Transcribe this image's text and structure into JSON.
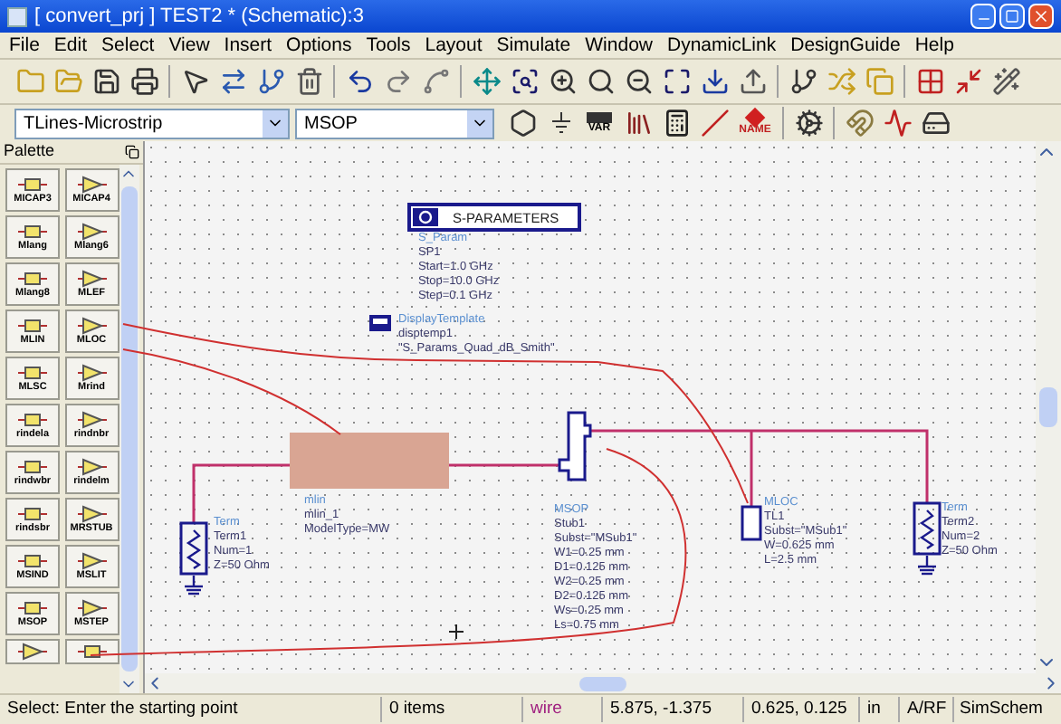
{
  "window": {
    "title": "[ convert_prj ] TEST2 * (Schematic):3"
  },
  "menu": [
    "File",
    "Edit",
    "Select",
    "View",
    "Insert",
    "Options",
    "Tools",
    "Layout",
    "Simulate",
    "Window",
    "DynamicLink",
    "DesignGuide",
    "Help"
  ],
  "component_bar": {
    "library": "TLines-Microstrip",
    "component": "MSOP",
    "var_icon_label": "VAR",
    "name_icon_label": "NAME"
  },
  "palette": {
    "title": "Palette",
    "items": [
      "MICAP3",
      "MICAP4",
      "Mlang",
      "Mlang6",
      "Mlang8",
      "MLEF",
      "MLIN",
      "MLOC",
      "MLSC",
      "Mrind",
      "rindela",
      "rindnbr",
      "rindwbr",
      "rindelm",
      "rindsbr",
      "MRSTUB",
      "MSIND",
      "MSLIT",
      "MSOP",
      "MSTEP"
    ]
  },
  "schematic": {
    "components": [
      {
        "kind": "s_parameters",
        "title": "S-PARAMETERS",
        "type": "S_Param",
        "lines": [
          "SP1",
          "Start=1.0 GHz",
          "Stop=10.0 GHz",
          "Step=0.1 GHz"
        ]
      },
      {
        "kind": "display_template",
        "type": "DisplayTemplate",
        "lines": [
          "disptemp1",
          "\"S_Params_Quad_dB_Smith\""
        ]
      },
      {
        "kind": "mlin",
        "type": "mlin",
        "lines": [
          "mlin_1",
          "ModelType=MW"
        ]
      },
      {
        "kind": "term",
        "type": "Term",
        "lines": [
          "Term1",
          "Num=1",
          "Z=50 Ohm"
        ]
      },
      {
        "kind": "msop",
        "type": "MSOP",
        "lines": [
          "Stub1",
          "Subst=\"MSub1\"",
          "W1=0.25 mm",
          "D1=0.125 mm",
          "W2=0.25 mm",
          "D2=0.125 mm",
          "Ws=0.25 mm",
          "Ls=0.75 mm"
        ]
      },
      {
        "kind": "mloc",
        "type": "MLOC",
        "lines": [
          "TL1",
          "Subst=\"MSub1\"",
          "W=0.625 mm",
          "L=2.5 mm"
        ]
      },
      {
        "kind": "term",
        "type": "Term",
        "lines": [
          "Term2",
          "Num=2",
          "Z=50 Ohm"
        ]
      }
    ]
  },
  "status_bar": {
    "prompt": "Select: Enter the starting point",
    "items": "0 items",
    "mode": "wire",
    "cursor": "5.875, -1.375",
    "offset": "0.625, 0.125",
    "units": "in",
    "domain": "A/RF",
    "simulator": "SimSchem"
  }
}
